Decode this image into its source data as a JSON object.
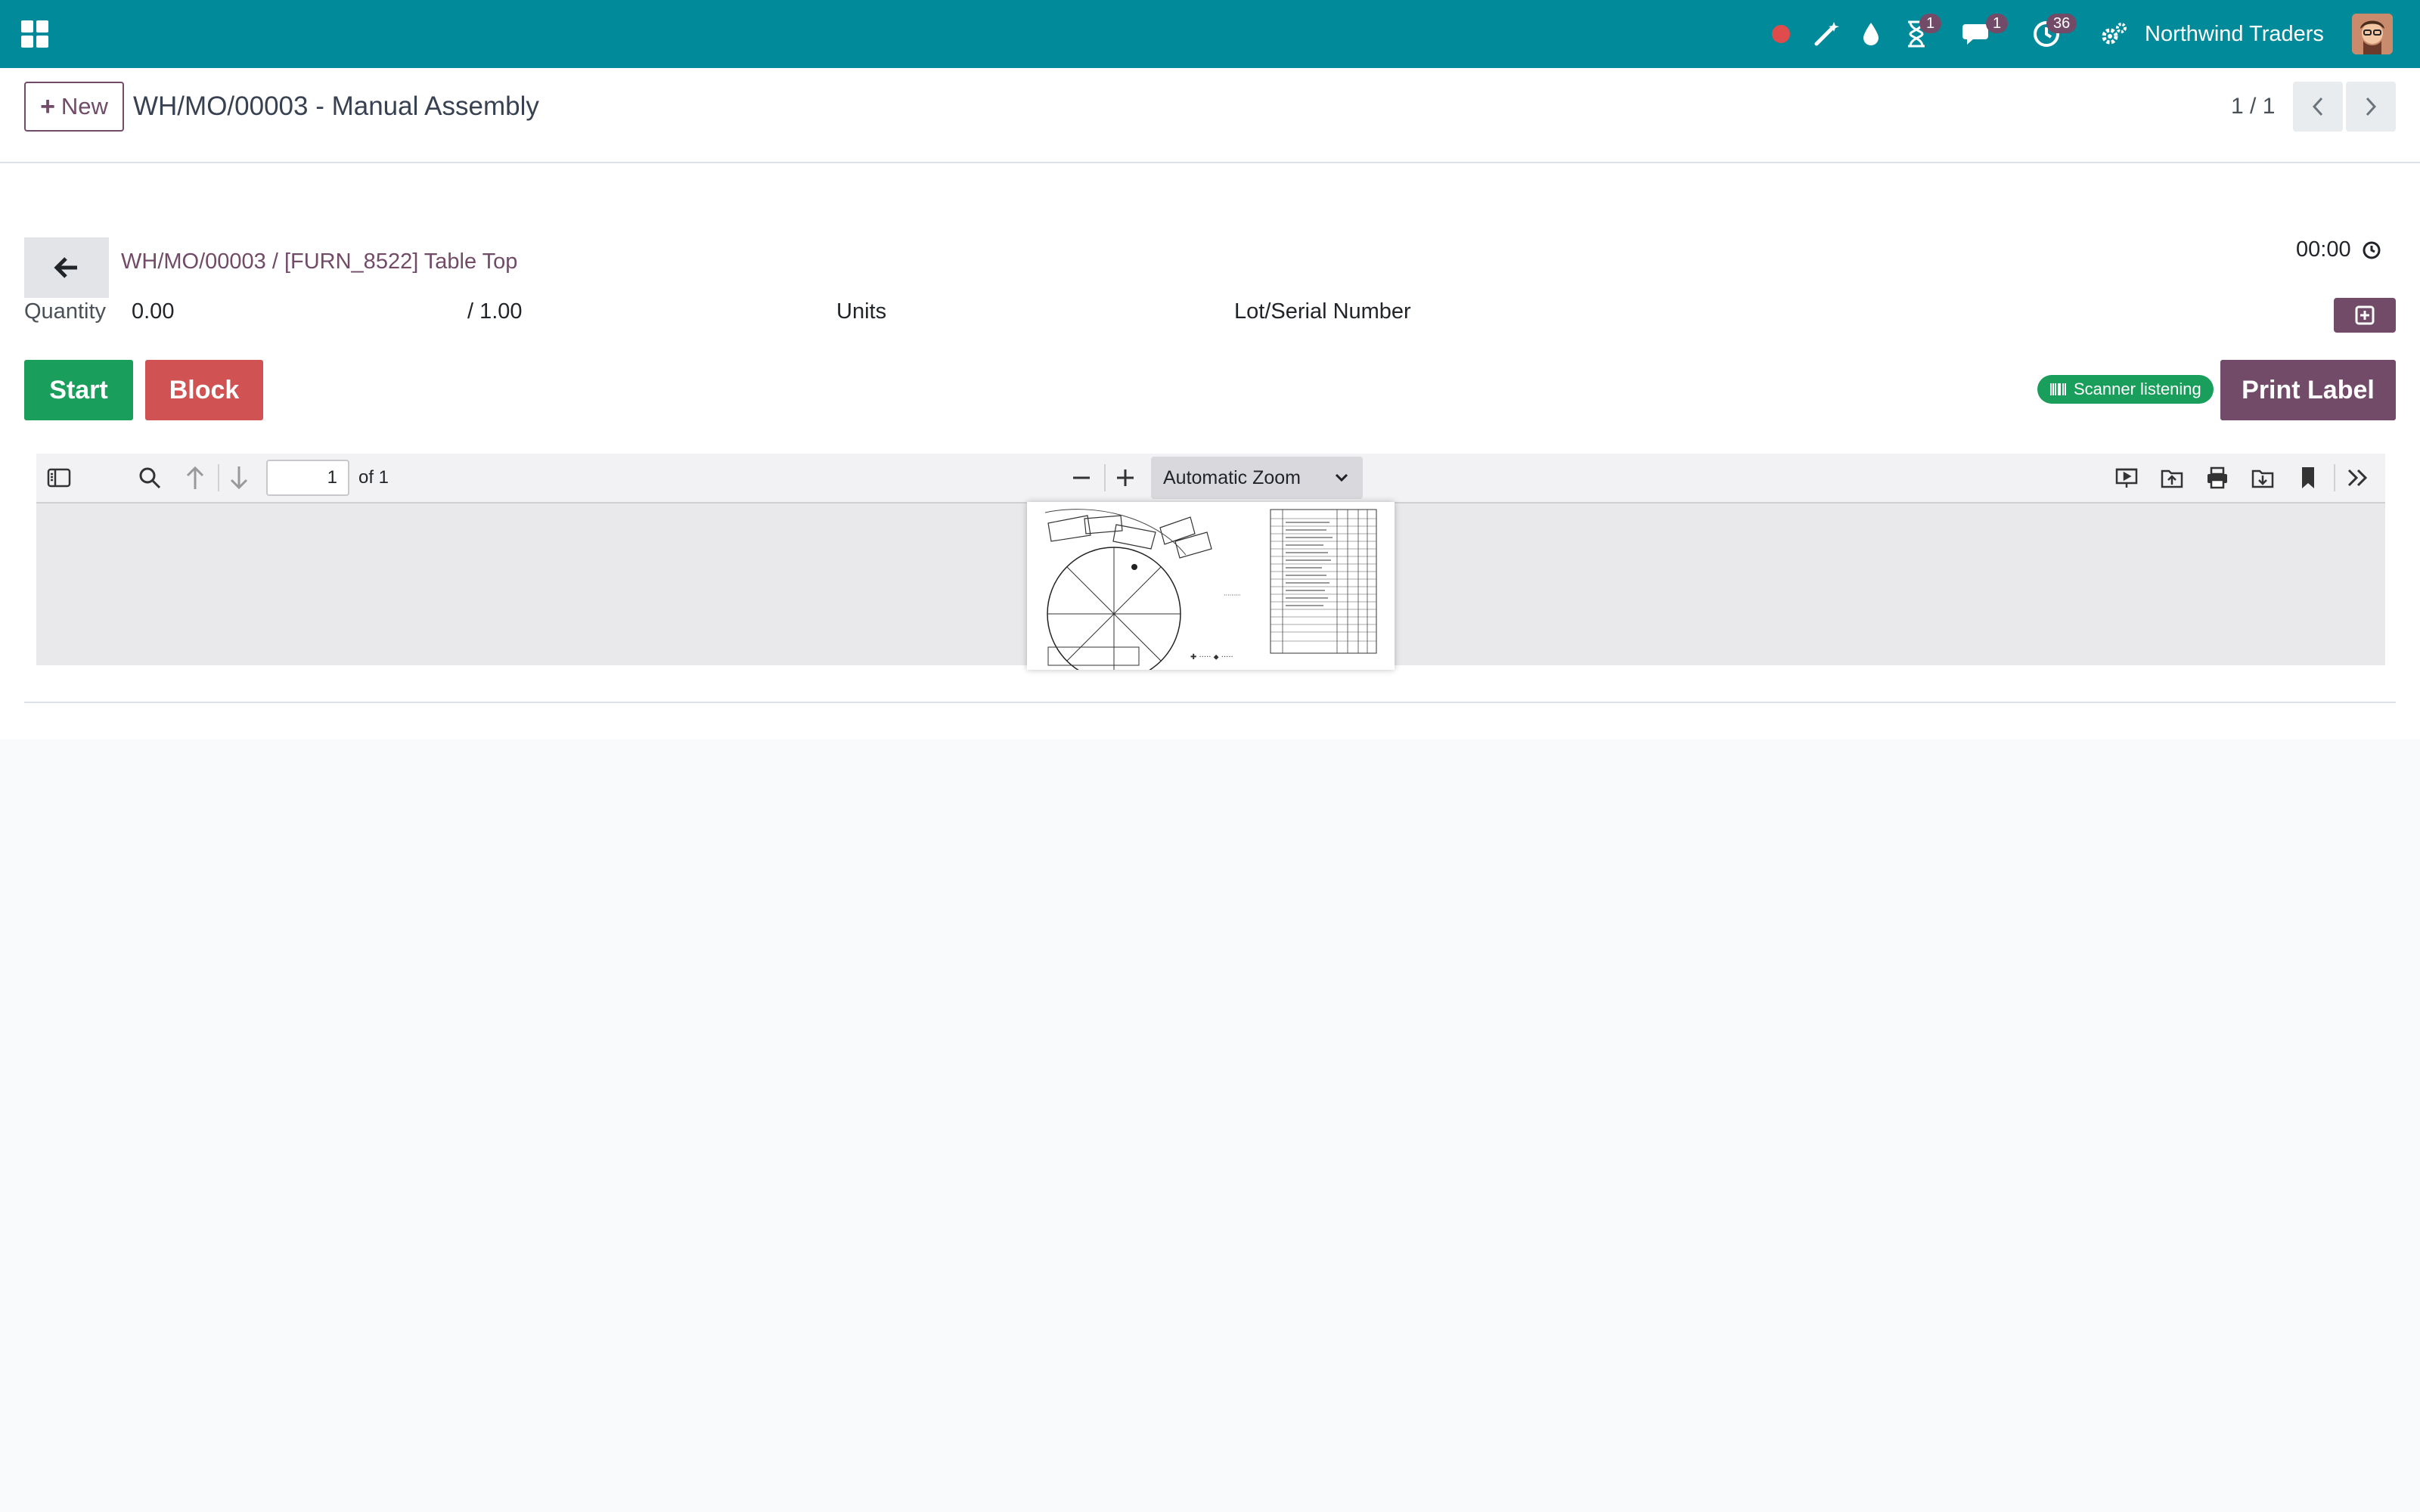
{
  "navbar": {
    "company": "Northwind Traders",
    "activity_badge": "1",
    "messages_badge": "1",
    "clock_badge": "36",
    "color": "#008a9a",
    "icons": [
      "apps-grid-icon",
      "recording-dot-icon",
      "magic-wand-icon",
      "droplet-icon",
      "hourglass-icon",
      "chat-icon",
      "clock-icon",
      "settings-icon"
    ]
  },
  "control_panel": {
    "new_label": "New",
    "record_title": "WH/MO/00003 - Manual Assembly",
    "pager": "1 / 1"
  },
  "workorder": {
    "breadcrumb": "WH/MO/00003 / [FURN_8522] Table Top",
    "timer": "00:00",
    "quantity_label": "Quantity",
    "quantity_done": "0.00",
    "quantity_total": "/ 1.00",
    "unit": "Units",
    "lot_label": "Lot/Serial Number",
    "start_label": "Start",
    "block_label": "Block",
    "scanner_label": "Scanner listening",
    "print_label": "Print Label",
    "colors": {
      "primary": "#714b67",
      "success": "#1a9e5c",
      "danger": "#d15252"
    }
  },
  "pdf_viewer": {
    "page_number": "1",
    "page_count": "of 1",
    "zoom": "Automatic Zoom"
  }
}
